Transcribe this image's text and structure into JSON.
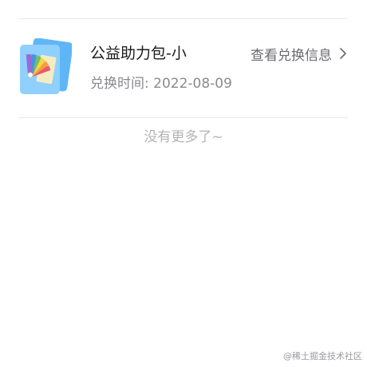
{
  "exchange_item": {
    "title": "公益助力包-小",
    "time": "兑换时间: 2022-08-09",
    "view_link_label": "查看兑换信息",
    "thumbnail_icon": "color-swatch-book-icon",
    "chevron_icon": "chevron-right-icon"
  },
  "list_footer": {
    "no_more_text": "没有更多了~"
  },
  "watermark": {
    "text": "@稀土掘金技术社区"
  },
  "colors": {
    "title": "#1a1a1a",
    "secondary": "#8a8a8f",
    "link": "#6a6a70",
    "footer": "#b4b4b8",
    "divider": "#e8e8ea",
    "thumb_back": "#5fb6f7",
    "thumb_front": "#8fd0ff"
  }
}
